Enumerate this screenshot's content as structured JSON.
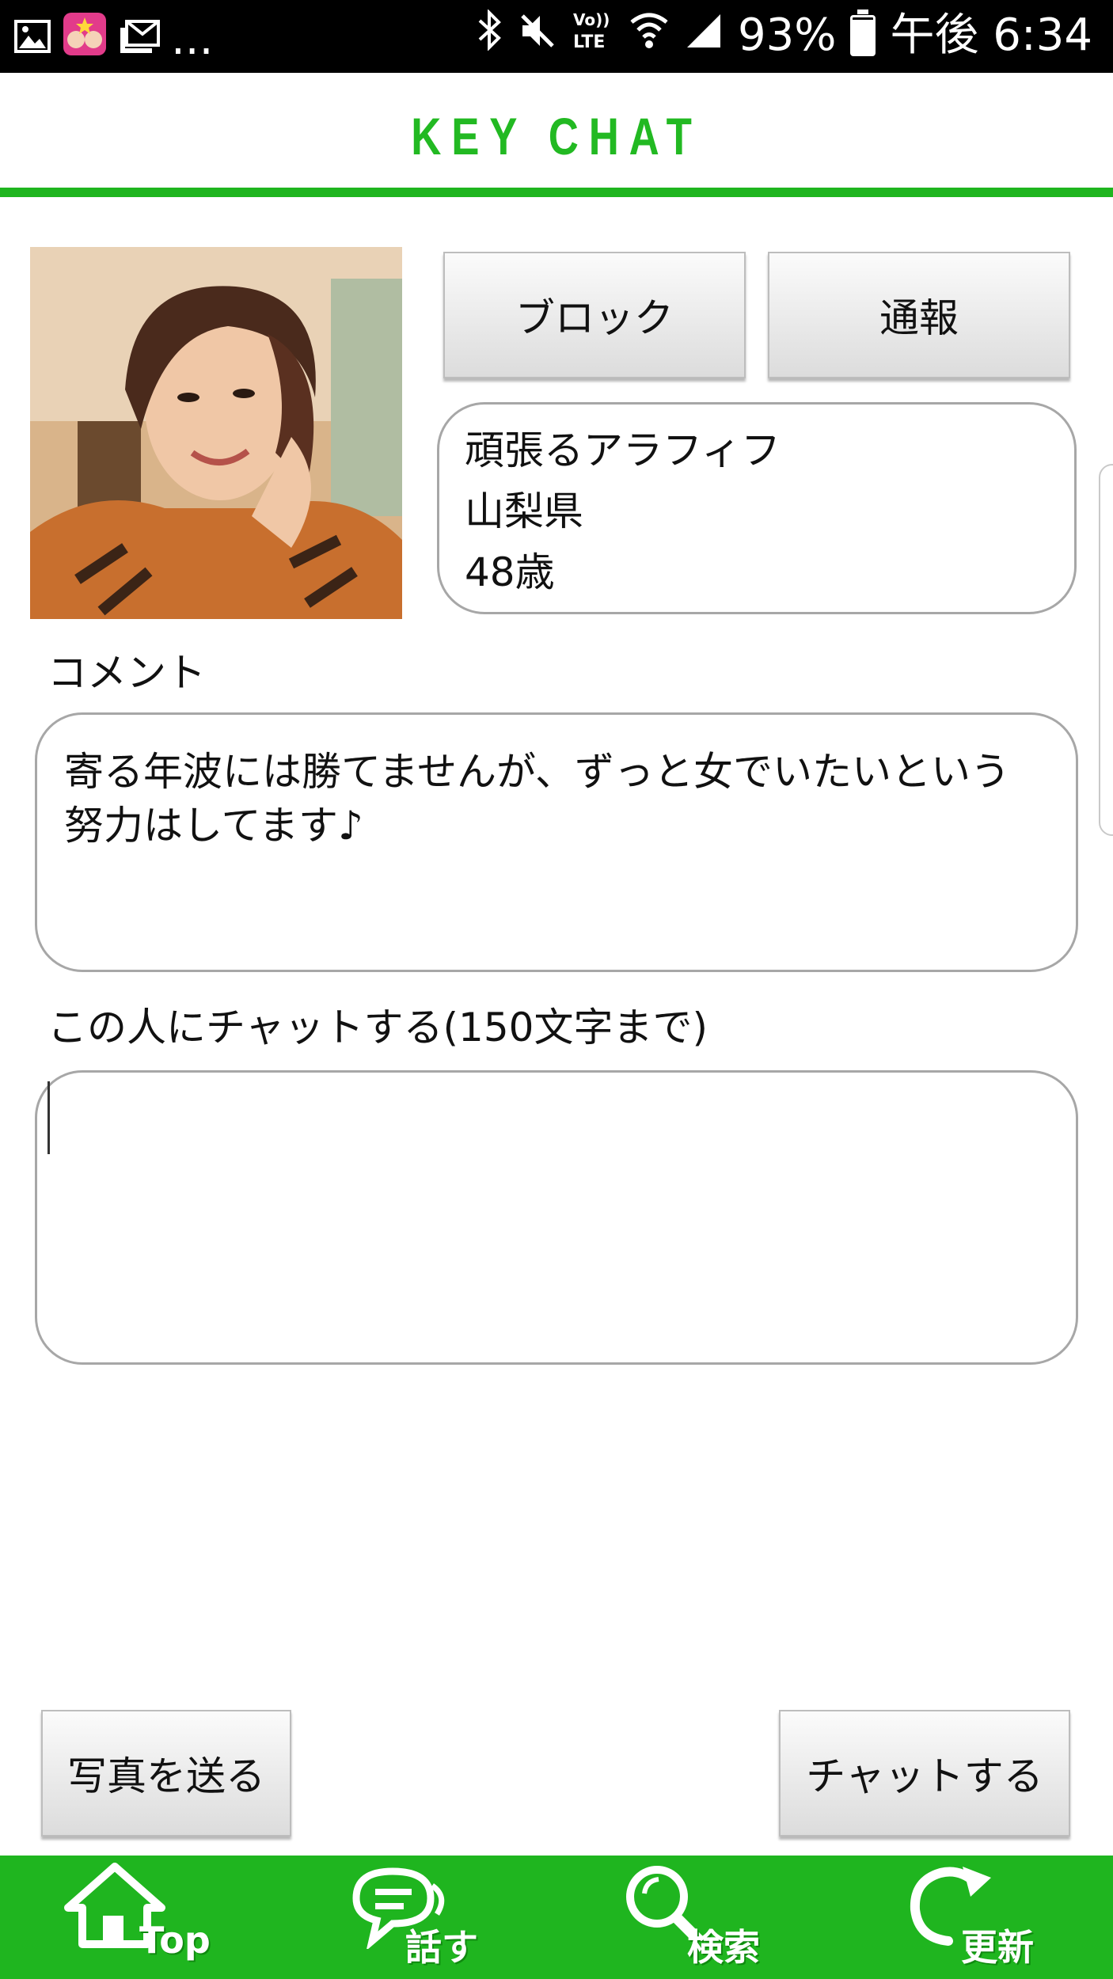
{
  "status_bar": {
    "battery": "93%",
    "time": "午後 6:34",
    "overflow": "...",
    "network": "LTE"
  },
  "header": {
    "title": "KEY CHAT"
  },
  "buttons": {
    "block": "ブロック",
    "report": "通報",
    "send_photo": "写真を送る",
    "chat": "チャットする"
  },
  "profile": {
    "nickname": "頑張るアラフィフ",
    "location": "山梨県",
    "age": "48歳"
  },
  "comment": {
    "label": "コメント",
    "text_line1": "寄る年波には勝てませんが、ずっと女でいたいという",
    "text_line2": "努力はしてます♪"
  },
  "chat_input": {
    "label": "この人にチャットする(150文字まで)",
    "value": ""
  },
  "bottom_nav": {
    "items": [
      {
        "label": "Top",
        "icon": "home-icon"
      },
      {
        "label": "話す",
        "icon": "speech-bubble-icon"
      },
      {
        "label": "検索",
        "icon": "magnifier-icon"
      },
      {
        "label": "更新",
        "icon": "refresh-icon"
      }
    ]
  },
  "colors": {
    "accent": "#1fb51f",
    "border": "#a7a7a7"
  }
}
